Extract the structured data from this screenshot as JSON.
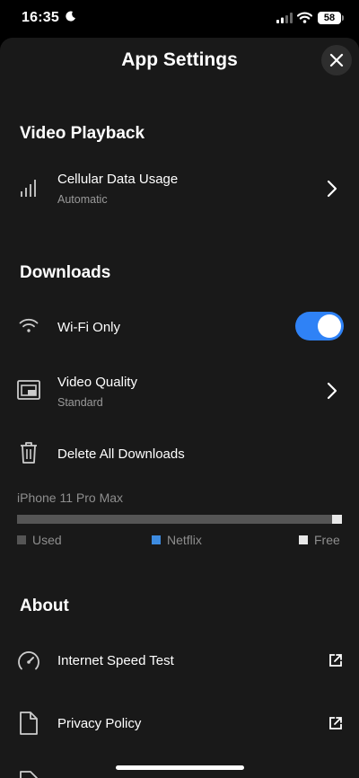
{
  "status_bar": {
    "time": "16:35",
    "battery": "58"
  },
  "header": {
    "title": "App Settings"
  },
  "video_playback": {
    "title": "Video Playback",
    "cellular": {
      "label": "Cellular Data Usage",
      "value": "Automatic"
    }
  },
  "downloads": {
    "title": "Downloads",
    "wifi_only": {
      "label": "Wi-Fi Only",
      "enabled": true
    },
    "video_quality": {
      "label": "Video Quality",
      "value": "Standard"
    },
    "delete_all": {
      "label": "Delete All Downloads"
    },
    "storage": {
      "device": "iPhone 11 Pro Max",
      "free_fraction": 0.03,
      "legend": {
        "used": "Used",
        "netflix": "Netflix",
        "free": "Free"
      },
      "colors": {
        "used": "#555555",
        "netflix": "#3d8be0",
        "free": "#e8e8e8"
      }
    }
  },
  "about": {
    "title": "About",
    "speed_test": {
      "label": "Internet Speed Test"
    },
    "privacy": {
      "label": "Privacy Policy"
    }
  },
  "colors": {
    "accent": "#2f82f6",
    "sheet_bg": "#191919"
  }
}
